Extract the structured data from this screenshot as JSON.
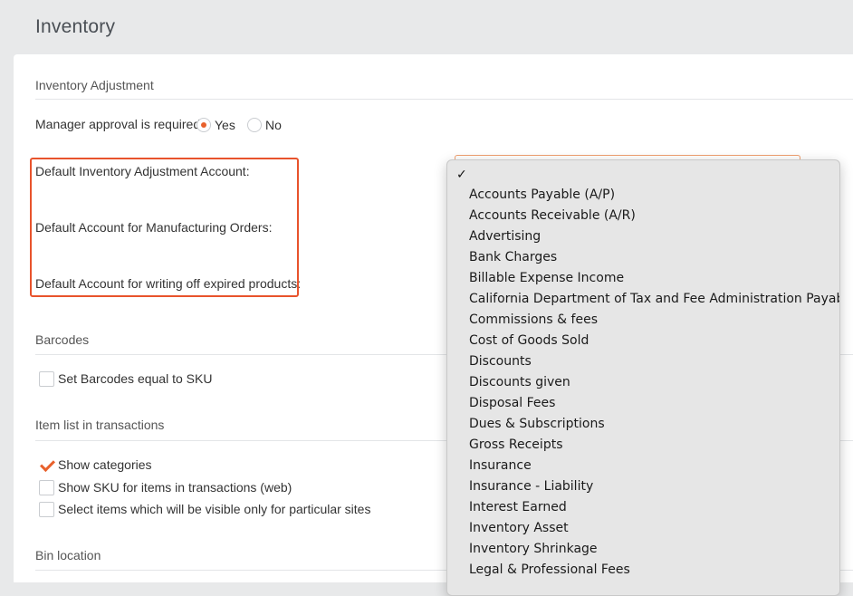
{
  "page": {
    "title": "Inventory"
  },
  "sections": {
    "inventory_adjustment": {
      "title": "Inventory Adjustment",
      "manager_approval_label": "Manager approval is required",
      "yes_label": "Yes",
      "no_label": "No",
      "selected": "Yes",
      "default_adjustment_account_label": "Default Inventory Adjustment Account:",
      "default_manufacturing_account_label": "Default Account for Manufacturing Orders:",
      "default_writeoff_account_label": "Default Account for writing off expired products:"
    },
    "barcodes": {
      "title": "Barcodes",
      "set_barcodes_label": "Set Barcodes equal to SKU",
      "set_barcodes_checked": false
    },
    "item_list": {
      "title": "Item list in transactions",
      "show_categories_label": "Show categories",
      "show_categories_checked": true,
      "show_sku_label": "Show SKU for items in transactions (web)",
      "show_sku_checked": false,
      "select_items_label": "Select items which will be visible only for particular sites",
      "select_items_checked": false
    },
    "bin_location": {
      "title": "Bin location"
    }
  },
  "dropdown": {
    "selected_mark": "✓",
    "options": [
      "Accounts Payable (A/P)",
      "Accounts Receivable (A/R)",
      "Advertising",
      "Bank Charges",
      "Billable Expense Income",
      "California Department of Tax and Fee Administration Payable",
      "Commissions & fees",
      "Cost of Goods Sold",
      "Discounts",
      "Discounts given",
      "Disposal Fees",
      "Dues & Subscriptions",
      "Gross Receipts",
      "Insurance",
      "Insurance - Liability",
      "Interest Earned",
      "Inventory Asset",
      "Inventory Shrinkage",
      "Legal & Professional Fees"
    ]
  },
  "colors": {
    "accent": "#e8612c",
    "highlight": "#e8532c"
  }
}
